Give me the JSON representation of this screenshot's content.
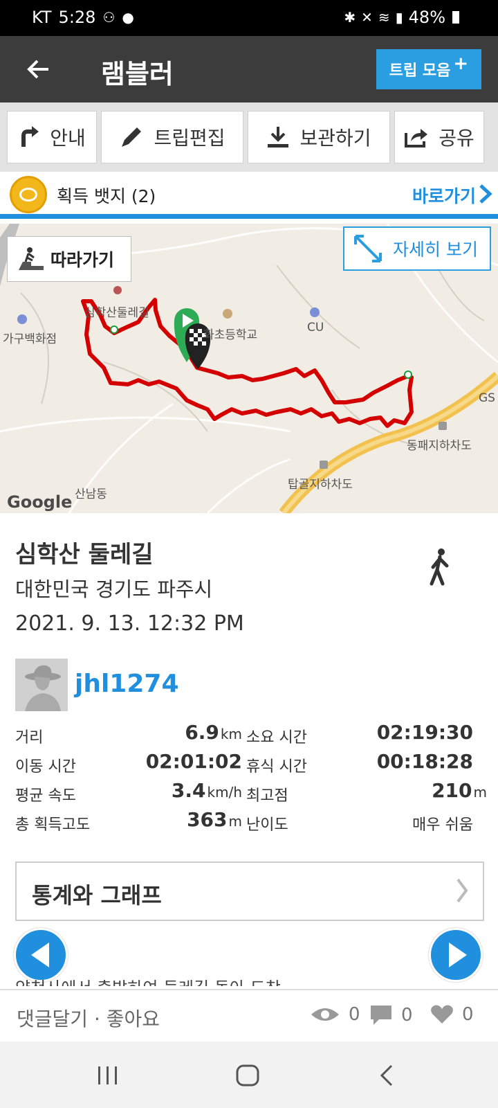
{
  "status_bar": {
    "carrier": "KT",
    "time": "5:28",
    "battery": "48%"
  },
  "app_bar": {
    "title": "램블러",
    "collect_button": "트립 모음"
  },
  "toolbar": {
    "guide": "안내",
    "edit": "트립편집",
    "save": "보관하기",
    "share": "공유"
  },
  "badge_bar": {
    "label": "획득 뱃지 (2)",
    "goto": "바로가기"
  },
  "map": {
    "follow_button": "따라가기",
    "detail_button": "자세히 보기",
    "labels": [
      "심학산둘레길",
      "가구백화점",
      "화초등학교",
      "CU",
      "GS",
      "동패지하차도",
      "탑골지하차도",
      "산남동"
    ],
    "attribution": "Google",
    "route_color": "#d40000"
  },
  "trip": {
    "title": "심학산 둘레길",
    "location": "대한민국 경기도 파주시",
    "date": "2021. 9. 13. 12:32 PM",
    "activity_icon": "walking-person-icon",
    "user": "jhl1274"
  },
  "stats": {
    "distance_label": "거리",
    "distance_value": "6.9",
    "distance_unit": "km",
    "duration_label": "소요 시간",
    "duration_value": "02:19:30",
    "moving_label": "이동 시간",
    "moving_value": "02:01:02",
    "rest_label": "휴식 시간",
    "rest_value": "00:18:28",
    "speed_label": "평균 속도",
    "speed_value": "3.4",
    "speed_unit": "km/h",
    "max_alt_label": "최고점",
    "max_alt_value": "210",
    "max_alt_unit": "m",
    "gain_label": "총 획득고도",
    "gain_value": "363",
    "gain_unit": "m",
    "difficulty_label": "난이도",
    "difficulty_value": "매우 쉬움"
  },
  "graphs_button": "통계와 그래프",
  "description_partial": "약천사에서 출발하여 둘레길 돌아 도착",
  "footer": {
    "comment_like": "댓글달기 · 좋아요",
    "views": "0",
    "comments": "0",
    "likes": "0"
  },
  "colors": {
    "accent": "#1f8fde",
    "appbar": "#3c3c3c"
  }
}
